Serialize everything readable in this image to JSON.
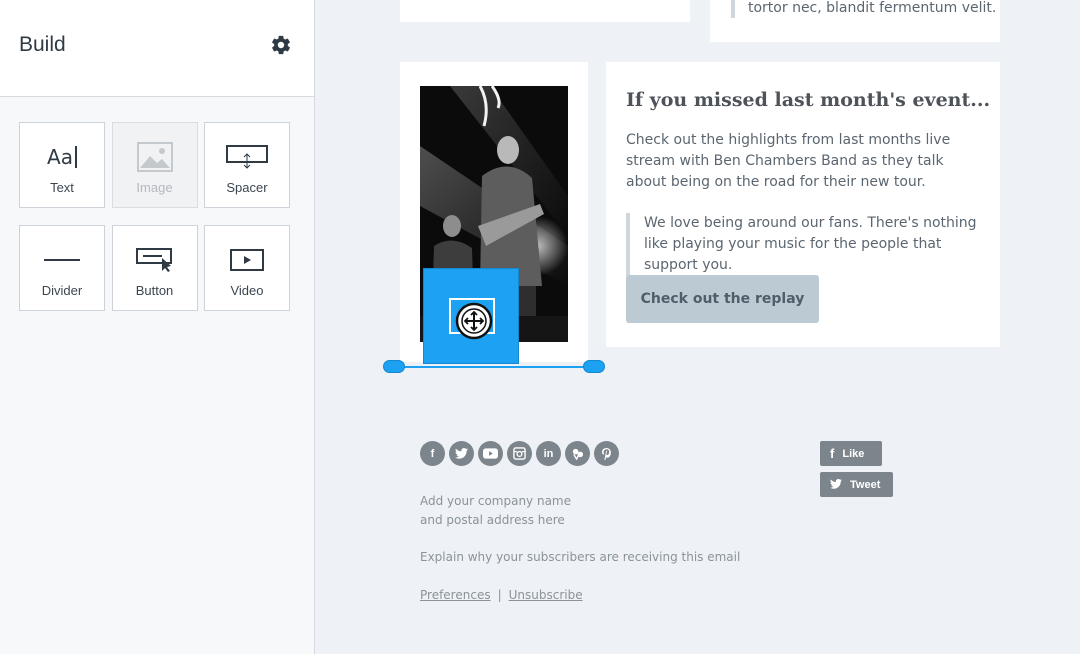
{
  "sidebar": {
    "title": "Build",
    "tiles": [
      {
        "label": "Text",
        "icon": "text-icon",
        "glyph": "Aa"
      },
      {
        "label": "Image",
        "icon": "image-icon"
      },
      {
        "label": "Spacer",
        "icon": "spacer-icon"
      },
      {
        "label": "Divider",
        "icon": "divider-icon"
      },
      {
        "label": "Button",
        "icon": "button-icon"
      },
      {
        "label": "Video",
        "icon": "video-icon"
      }
    ]
  },
  "email": {
    "top_quote": "tortor nec, blandit fermentum velit.",
    "heading": "If you missed last month's event...",
    "body": "Check out the highlights from last months live stream with Ben Chambers Band as they talk about being on the road for their new tour.",
    "quote": "We love being around our fans. There's nothing like playing your music for the people that support you.",
    "button_label": "Check out the replay"
  },
  "footer": {
    "social_icons": [
      "facebook-icon",
      "twitter-icon",
      "youtube-icon",
      "instagram-icon",
      "linkedin-icon",
      "vine-icon",
      "pinterest-icon"
    ],
    "like_label": "Like",
    "tweet_label": "Tweet",
    "address_line1": "Add your company name",
    "address_line2": "and postal address here",
    "reason": "Explain why your subscribers are receiving this email",
    "preferences": "Preferences",
    "separator": "|",
    "unsubscribe": "Unsubscribe"
  },
  "colors": {
    "accent": "#1da1f2",
    "button_bg": "#bccbd3",
    "social_bg": "#7d858c"
  }
}
